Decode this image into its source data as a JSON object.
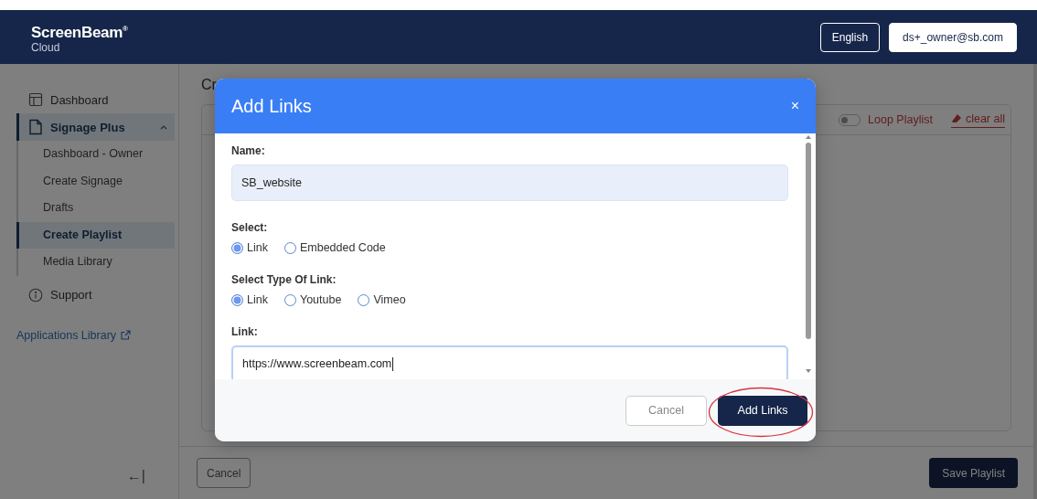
{
  "header": {
    "logo": "ScreenBeam",
    "logo_mark": "®",
    "subtitle": "Cloud",
    "language_button": "English",
    "account_button": "ds+_owner@sb.com"
  },
  "sidebar": {
    "items": [
      {
        "label": "Dashboard",
        "selected": false
      },
      {
        "label": "Signage Plus",
        "selected": true,
        "expanded": true,
        "children": [
          {
            "label": "Dashboard - Owner",
            "selected": false
          },
          {
            "label": "Create Signage",
            "selected": false
          },
          {
            "label": "Drafts",
            "selected": false
          },
          {
            "label": "Create Playlist",
            "selected": true
          },
          {
            "label": "Media Library",
            "selected": false
          }
        ]
      },
      {
        "label": "Support",
        "selected": false
      }
    ],
    "link": "Applications Library",
    "collapse": "←|"
  },
  "main": {
    "title": "Cr",
    "loop_toggle": {
      "label": "Loop Playlist",
      "on": false
    },
    "clear_all": "clear all",
    "cancel_button": "Cancel",
    "save_button": "Save Playlist"
  },
  "modal": {
    "title": "Add Links",
    "close": "×",
    "name": {
      "label": "Name:",
      "value": "SB_website"
    },
    "select": {
      "label": "Select:",
      "options": [
        {
          "label": "Link",
          "selected": true
        },
        {
          "label": "Embedded Code",
          "selected": false
        }
      ]
    },
    "link_type": {
      "label": "Select Type Of Link:",
      "options": [
        {
          "label": "Link",
          "selected": true
        },
        {
          "label": "Youtube",
          "selected": false
        },
        {
          "label": "Vimeo",
          "selected": false
        }
      ]
    },
    "link": {
      "label": "Link:",
      "value": "https://www.screenbeam.com"
    },
    "cancel_button": "Cancel",
    "submit_button": "Add Links"
  }
}
